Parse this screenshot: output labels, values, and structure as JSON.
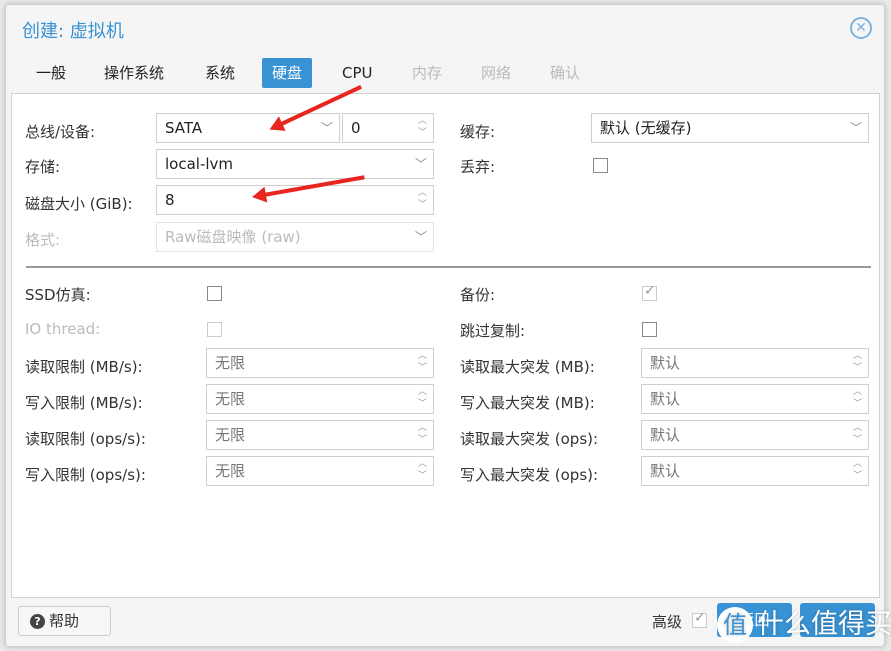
{
  "dialog": {
    "title": "创建: 虚拟机",
    "close_icon": "close-circle-icon"
  },
  "tabs": [
    {
      "label": "一般"
    },
    {
      "label": "操作系统"
    },
    {
      "label": "系统"
    },
    {
      "label": "硬盘",
      "active": true
    },
    {
      "label": "CPU"
    },
    {
      "label": "内存",
      "disabled": true
    },
    {
      "label": "网络",
      "disabled": true
    },
    {
      "label": "确认",
      "disabled": true
    }
  ],
  "form": {
    "bus_label": "总线/设备:",
    "bus_value": "SATA",
    "device_value": "0",
    "storage_label": "存储:",
    "storage_value": "local-lvm",
    "size_label": "磁盘大小 (GiB):",
    "size_value": "8",
    "format_label": "格式:",
    "format_value": "Raw磁盘映像 (raw)",
    "cache_label": "缓存:",
    "cache_value": "默认 (无缓存)",
    "discard_label": "丢弃:",
    "discard_checked": false,
    "ssd_label": "SSD仿真:",
    "ssd_checked": false,
    "iothread_label": "IO thread:",
    "iothread_checked": false,
    "backup_label": "备份:",
    "backup_checked": true,
    "skip_repl_label": "跳过复制:",
    "skip_repl_checked": false,
    "limits": [
      {
        "label": "读取限制 (MB/s):",
        "placeholder": "无限"
      },
      {
        "label": "写入限制 (MB/s):",
        "placeholder": "无限"
      },
      {
        "label": "读取限制 (ops/s):",
        "placeholder": "无限"
      },
      {
        "label": "写入限制 (ops/s):",
        "placeholder": "无限"
      }
    ],
    "bursts": [
      {
        "label": "读取最大突发 (MB):",
        "placeholder": "默认"
      },
      {
        "label": "写入最大突发 (MB):",
        "placeholder": "默认"
      },
      {
        "label": "读取最大突发 (ops):",
        "placeholder": "默认"
      },
      {
        "label": "写入最大突发 (ops):",
        "placeholder": "默认"
      }
    ]
  },
  "footer": {
    "help_label": "帮助",
    "advanced_label": "高级",
    "advanced_checked": true,
    "back_label": "返回"
  },
  "watermark": {
    "logo": "值",
    "text": "什么值得买"
  },
  "colors": {
    "accent": "#3892d4",
    "annotation_arrow": "#e8251f"
  }
}
